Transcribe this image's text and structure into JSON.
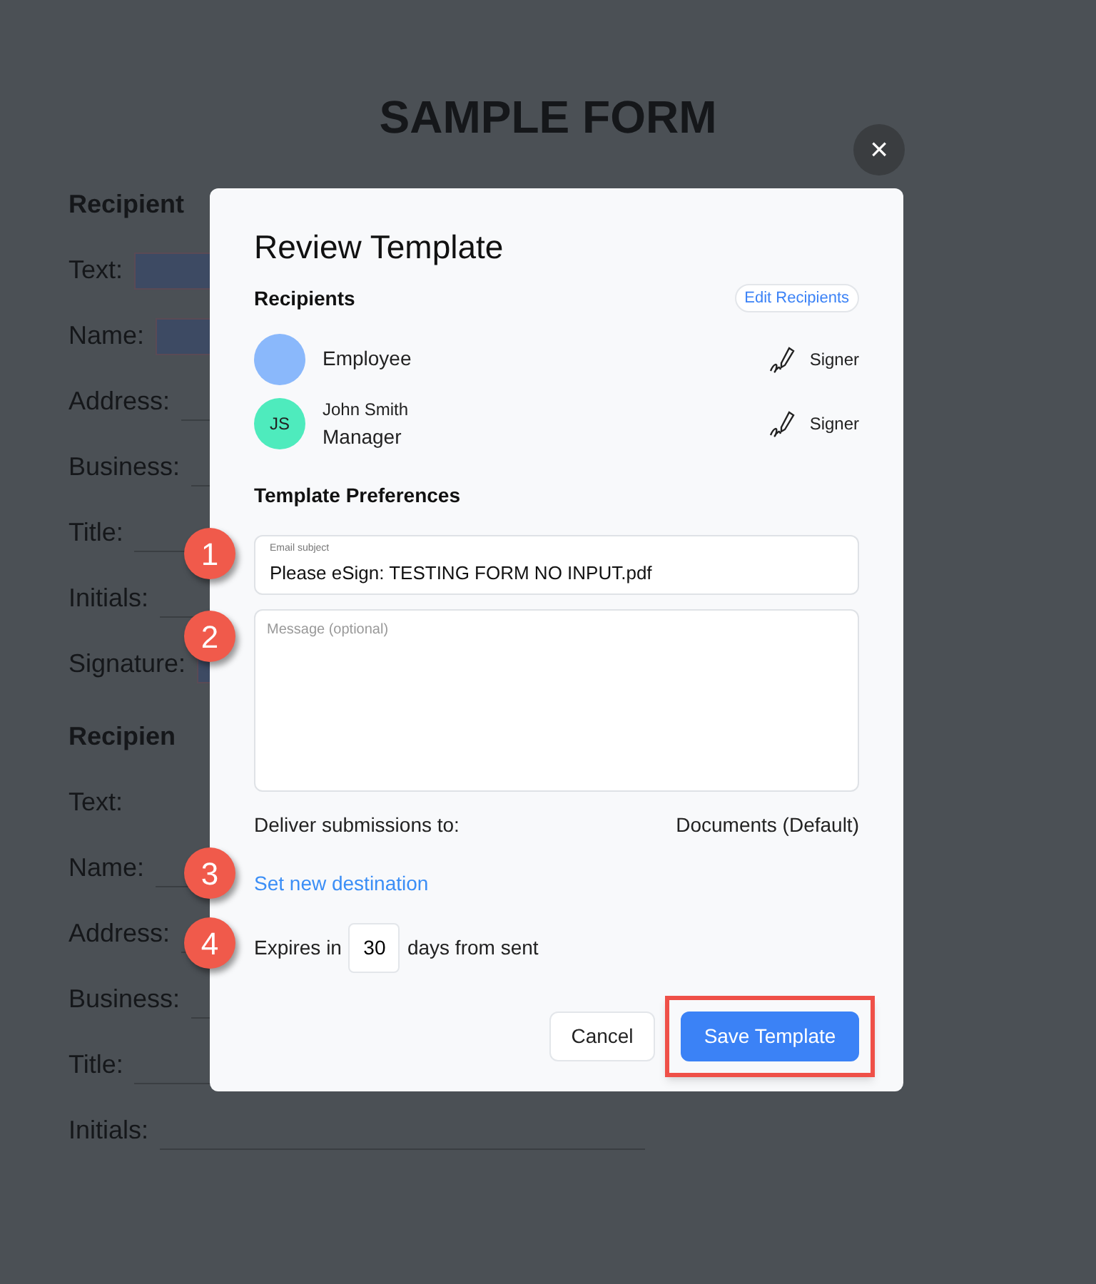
{
  "background": {
    "title": "SAMPLE FORM",
    "sections": [
      {
        "heading": "Recipient",
        "fields": [
          {
            "label": "Text:",
            "kind": "box"
          },
          {
            "label": "Name:",
            "kind": "box"
          },
          {
            "label": "Address:",
            "kind": "line"
          },
          {
            "label": "Business:",
            "kind": "line"
          },
          {
            "label": "Title:",
            "kind": "line"
          },
          {
            "label": "Initials:",
            "kind": "line"
          },
          {
            "label": "Signature:",
            "kind": "box"
          }
        ]
      },
      {
        "heading": "Recipien",
        "fields": [
          {
            "label": "Text:",
            "kind": "none"
          },
          {
            "label": "Name:",
            "kind": "line"
          },
          {
            "label": "Address:",
            "kind": "line"
          },
          {
            "label": "Business:",
            "kind": "line"
          },
          {
            "label": "Title:",
            "kind": "line"
          },
          {
            "label": "Initials:",
            "kind": "line"
          }
        ]
      }
    ]
  },
  "dialog": {
    "close": "×",
    "title": "Review Template",
    "recipients_label": "Recipients",
    "edit_recipients": "Edit Recipients",
    "recipients": [
      {
        "role": "Employee",
        "color": "#8ab8fb",
        "type": "Signer"
      },
      {
        "initials": "JS",
        "name": "John Smith",
        "role": "Manager",
        "color": "#4eebbd",
        "type": "Signer"
      }
    ],
    "preferences_label": "Template Preferences",
    "email_subject": {
      "label": "Email subject",
      "value": "Please eSign: TESTING FORM NO INPUT.pdf"
    },
    "message": {
      "placeholder": "Message (optional)"
    },
    "deliver_label": "Deliver submissions to:",
    "deliver_value": "Documents (Default)",
    "set_destination": "Set new destination",
    "expires": {
      "before": "Expires in",
      "value": "30",
      "after": "days from sent"
    },
    "buttons": [
      {
        "label": "Cancel",
        "kind": "secondary",
        "highlighted": false
      },
      {
        "label": "Save Template",
        "kind": "primary",
        "highlighted": true
      }
    ]
  },
  "annotations": [
    "1",
    "2",
    "3",
    "4"
  ]
}
